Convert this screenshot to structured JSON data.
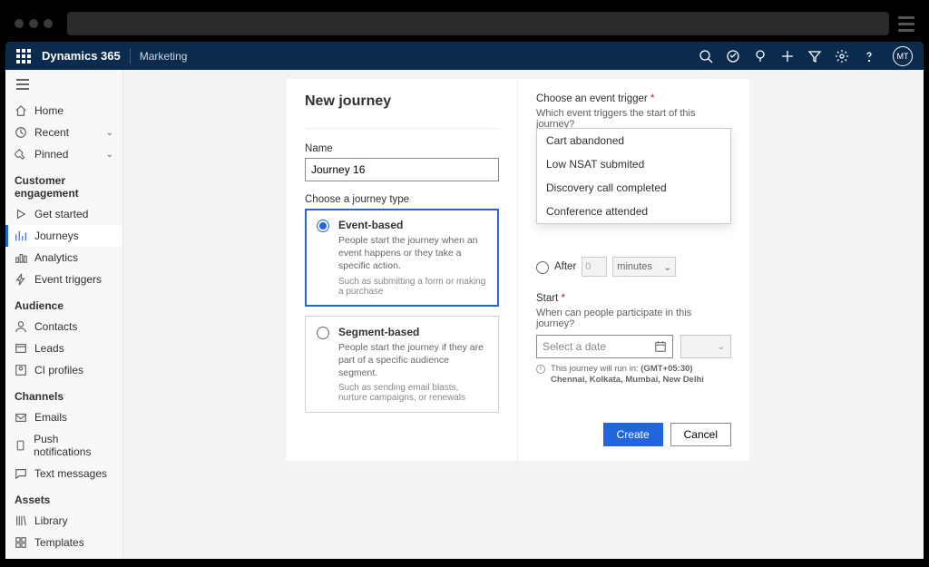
{
  "topbar": {
    "brand": "Dynamics 365",
    "module": "Marketing",
    "avatar": "MT"
  },
  "sidebar": {
    "home": "Home",
    "recent": "Recent",
    "pinned": "Pinned",
    "sections": {
      "engagement": {
        "title": "Customer engagement",
        "items": [
          "Get started",
          "Journeys",
          "Analytics",
          "Event triggers"
        ]
      },
      "audience": {
        "title": "Audience",
        "items": [
          "Contacts",
          "Leads",
          "CI profiles"
        ]
      },
      "channels": {
        "title": "Channels",
        "items": [
          "Emails",
          "Push notifications",
          "Text messages"
        ]
      },
      "assets": {
        "title": "Assets",
        "items": [
          "Library",
          "Templates"
        ]
      }
    }
  },
  "form": {
    "title": "New journey",
    "name_label": "Name",
    "name_value": "Journey 16",
    "type_label": "Choose a journey type",
    "type_event": {
      "title": "Event-based",
      "desc": "People start the journey when an event happens or they take a specific action.",
      "hint": "Such as submitting a form or making a purchase"
    },
    "type_segment": {
      "title": "Segment-based",
      "desc": "People start the journey if they are part of a specific audience segment.",
      "hint": "Such as sending email blasts, nurture campaigns, or renewals"
    },
    "trigger": {
      "label": "Choose an event trigger",
      "sublabel": "Which event triggers the start of this journey?",
      "selected": "Cart abandoned",
      "options": [
        "Cart abandoned",
        "Low NSAT submited",
        "Discovery call completed",
        "Conference attended"
      ]
    },
    "after": {
      "label": "After",
      "num": "0",
      "unit": "minutes"
    },
    "start": {
      "label": "Start",
      "sublabel": "When can people participate in this journey?",
      "placeholder": "Select a date"
    },
    "tz_prefix": "This journey will run in:",
    "tz_value": "(GMT+05:30) Chennai, Kolkata, Mumbai, New Delhi",
    "create": "Create",
    "cancel": "Cancel"
  }
}
